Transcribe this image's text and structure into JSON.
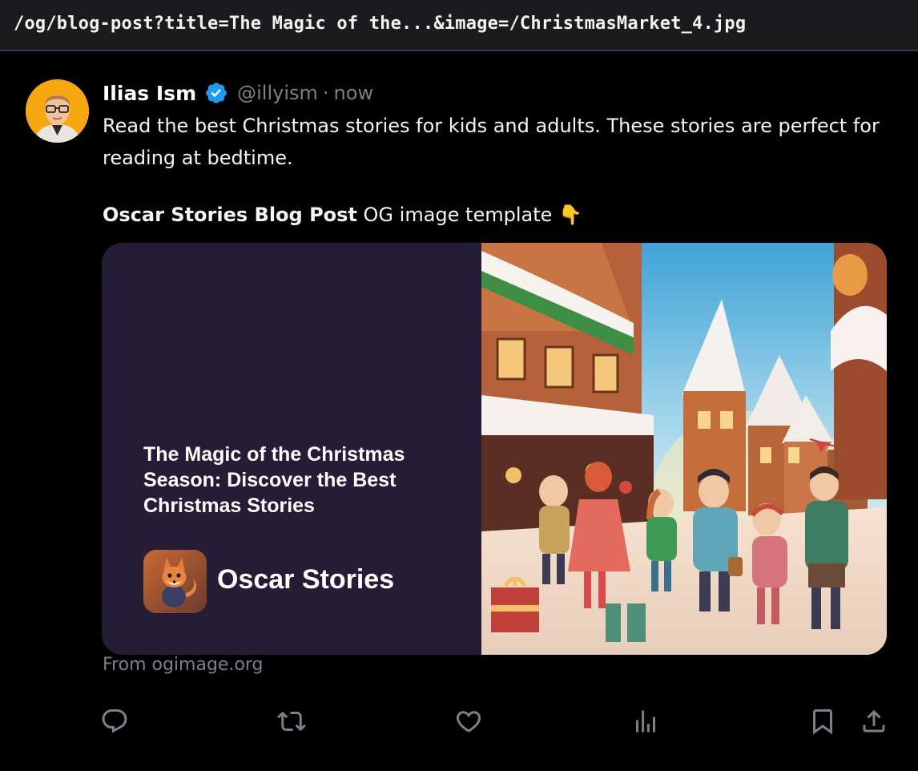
{
  "address_bar": {
    "url": "/og/blog-post?title=The Magic of the...&image=/ChristmasMarket_4.jpg"
  },
  "tweet": {
    "author_name": "Ilias Ism",
    "handle": "@illyism",
    "separator": "·",
    "timestamp": "now",
    "text": "Read the best Christmas stories for kids and adults. These stories are perfect for reading at bedtime.",
    "template_line_bold": "Oscar Stories Blog Post",
    "template_line_rest": " OG image template 👇",
    "source": "From ogimage.org"
  },
  "card": {
    "title": "The Magic of the Christmas Season: Discover the Best Christmas Stories",
    "brand": "Oscar Stories"
  },
  "actions": [
    "reply-icon",
    "retweet-icon",
    "like-icon",
    "views-icon",
    "bookmark-icon",
    "share-icon"
  ],
  "colors": {
    "background": "#000000",
    "muted": "#7b8087",
    "verified": "#1d9bf0",
    "card_bg": "#251d35",
    "avatar_bg": "#f6a70f"
  }
}
